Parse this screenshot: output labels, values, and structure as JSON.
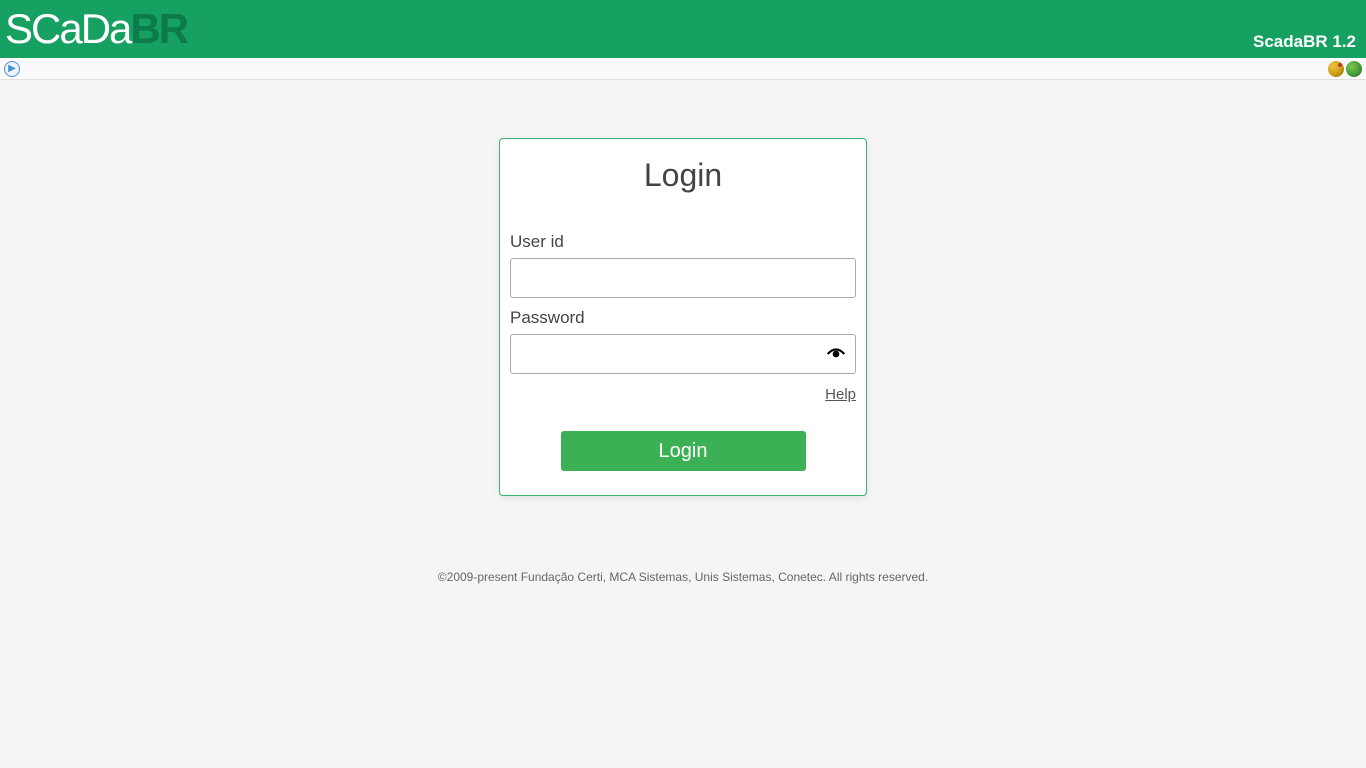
{
  "header": {
    "logo_scada": "SCaDa",
    "logo_br": "BR",
    "version": "ScadaBR 1.2"
  },
  "login": {
    "title": "Login",
    "user_id_label": "User id",
    "user_id_value": "",
    "password_label": "Password",
    "password_value": "",
    "help_link": "Help",
    "login_button": "Login"
  },
  "footer": {
    "copyright": "©2009-present Fundação Certi, MCA Sistemas, Unis Sistemas, Conetec. All rights reserved."
  }
}
